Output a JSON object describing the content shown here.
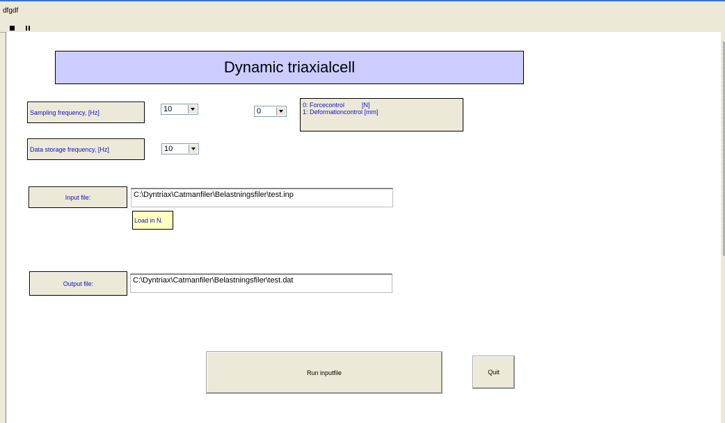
{
  "window": {
    "title": "dfgdf"
  },
  "header": {
    "title": "Dynamic triaxialcell"
  },
  "sampling": {
    "label": "Sampling frequency, [Hz]",
    "value": "10"
  },
  "mode": {
    "value": "0",
    "line1": "0: Forcecontrol          [N]",
    "line2": "1: Deformationcontrol [mm]"
  },
  "storage": {
    "label": "Data storage frequency, [Hz]",
    "value": "10"
  },
  "input": {
    "label": "Input file:",
    "value": "C:\\Dyntriax\\Catmanfiler\\Belastningsfiler\\test.inp",
    "note": "Load in N."
  },
  "output": {
    "label": "Output file:",
    "value": "C:\\Dyntriax\\Catmanfiler\\Belastningsfiler\\test.dat"
  },
  "buttons": {
    "run": "Run inputfile",
    "quit": "Quit"
  },
  "colors": {
    "title_panel": "#ccccff",
    "label_text": "#1010c0",
    "note_bg": "#ffffc0"
  }
}
